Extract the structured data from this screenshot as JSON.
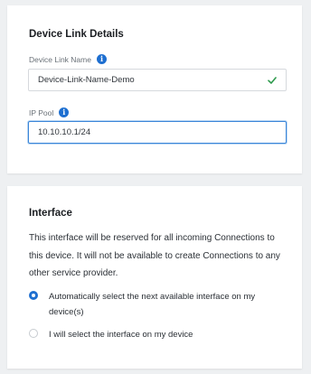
{
  "device_link": {
    "section_title": "Device Link Details",
    "name_label": "Device Link Name",
    "name_value": "Device-Link-Name-Demo",
    "ip_pool_label": "IP Pool",
    "ip_pool_value": "10.10.10.1/24",
    "valid_color": "#2e9a4d"
  },
  "interface": {
    "section_title": "Interface",
    "description": "This interface will be reserved for all incoming Connections to this device. It will not be available to create Connections to any other service provider.",
    "options": [
      {
        "label": "Automatically select the next available interface on my device(s)",
        "selected": true
      },
      {
        "label": "I will select the interface on my device",
        "selected": false
      }
    ]
  },
  "accent_color": "#1e6fd0"
}
